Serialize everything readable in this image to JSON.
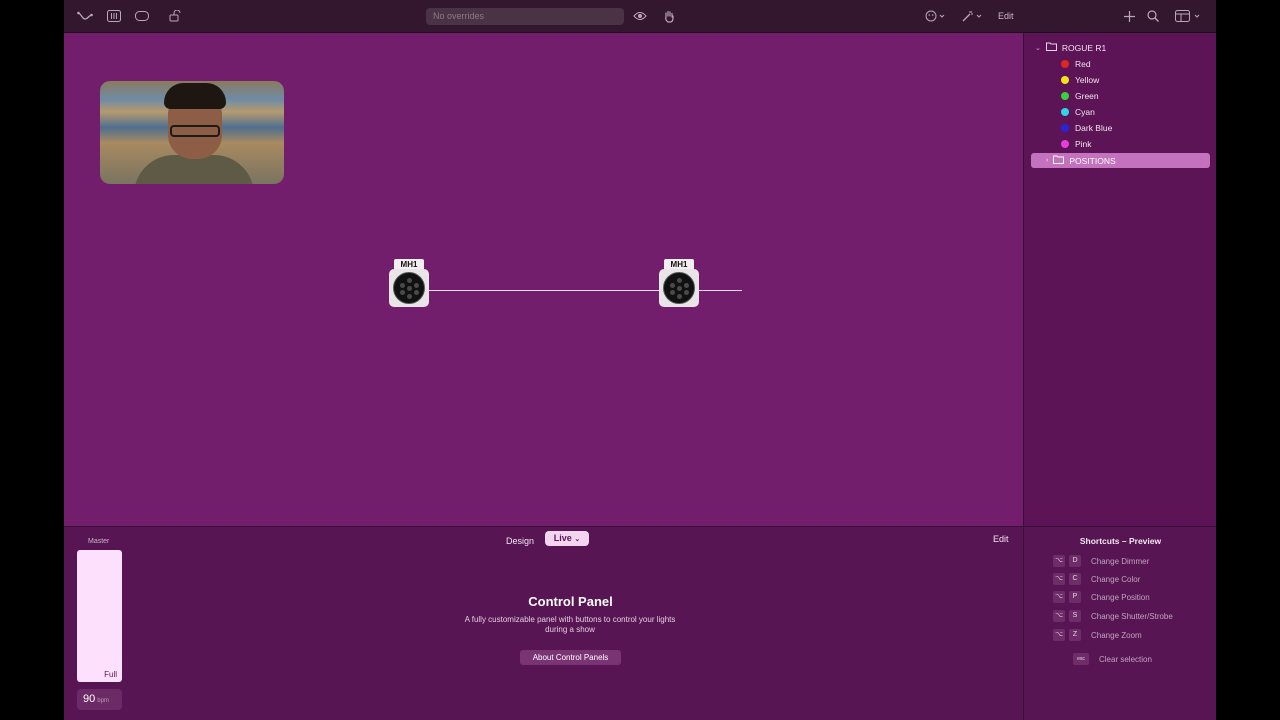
{
  "toolbar": {
    "overrides_placeholder": "No overrides",
    "edit_label": "Edit",
    "icons": [
      "curve-tool-icon",
      "bars-tool-icon",
      "shape-tool-icon",
      "lock-icon",
      "eye-icon",
      "hand-icon",
      "face-icon",
      "magic-wand-icon",
      "plus-icon",
      "search-icon",
      "layout-icon"
    ]
  },
  "canvas": {
    "fixtures": [
      {
        "label": "MH1"
      },
      {
        "label": "MH1"
      }
    ]
  },
  "sidebar": {
    "root": "ROGUE R1",
    "items": [
      {
        "label": "Red",
        "color": "#e0261f"
      },
      {
        "label": "Yellow",
        "color": "#f2e21b"
      },
      {
        "label": "Green",
        "color": "#35d43b"
      },
      {
        "label": "Cyan",
        "color": "#2fd7e6"
      },
      {
        "label": "Dark Blue",
        "color": "#2a24d9"
      },
      {
        "label": "Pink",
        "color": "#e63fd9"
      }
    ],
    "selected": "POSITIONS"
  },
  "bottom": {
    "master_label": "Master",
    "fader_value": "Full",
    "bpm_value": "90",
    "bpm_unit": "bpm",
    "mode_design": "Design",
    "mode_live": "Live",
    "edit_label": "Edit",
    "panel_title": "Control Panel",
    "panel_desc_line1": "A fully customizable panel with buttons to control your lights",
    "panel_desc_line2": "during a show",
    "about_button": "About Control Panels"
  },
  "shortcuts": {
    "title": "Shortcuts – Preview",
    "items": [
      {
        "key": "D",
        "label": "Change Dimmer"
      },
      {
        "key": "C",
        "label": "Change Color"
      },
      {
        "key": "P",
        "label": "Change Position"
      },
      {
        "key": "S",
        "label": "Change Shutter/Strobe"
      },
      {
        "key": "Z",
        "label": "Change Zoom"
      }
    ],
    "esc_key": "esc",
    "esc_label": "Clear selection"
  }
}
